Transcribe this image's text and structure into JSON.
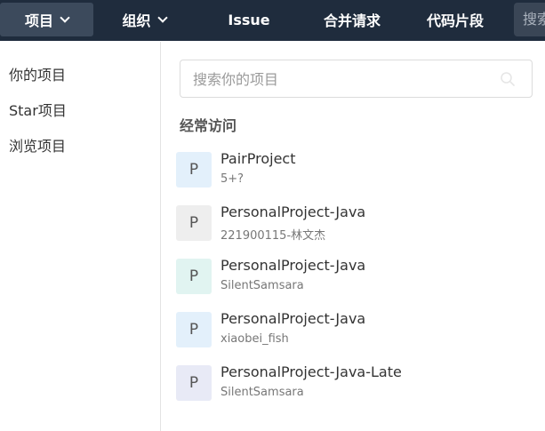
{
  "nav": {
    "items": [
      {
        "label": "项目",
        "has_dropdown": true,
        "active": true
      },
      {
        "label": "组织",
        "has_dropdown": true,
        "active": false
      },
      {
        "label": "Issue",
        "has_dropdown": false,
        "active": false
      },
      {
        "label": "合并请求",
        "has_dropdown": false,
        "active": false
      },
      {
        "label": "代码片段",
        "has_dropdown": false,
        "active": false
      }
    ],
    "search_text": "搜索"
  },
  "sidebar": {
    "items": [
      {
        "label": "你的项目"
      },
      {
        "label": "Star项目"
      },
      {
        "label": "浏览项目"
      }
    ]
  },
  "main": {
    "search": {
      "placeholder": "搜索你的项目",
      "value": ""
    },
    "section_title": "经常访问",
    "projects": [
      {
        "initial": "P",
        "name": "PairProject",
        "owner": "5+?",
        "avatar_color": "#e3f0fb"
      },
      {
        "initial": "P",
        "name": "PersonalProject-Java",
        "owner": "221900115-林文杰",
        "avatar_color": "#eeeeee"
      },
      {
        "initial": "P",
        "name": "PersonalProject-Java",
        "owner": "SilentSamsara",
        "avatar_color": "#e1f4f1"
      },
      {
        "initial": "P",
        "name": "PersonalProject-Java",
        "owner": "xiaobei_fish",
        "avatar_color": "#e3f0fb"
      },
      {
        "initial": "P",
        "name": "PersonalProject-Java-Late",
        "owner": "SilentSamsara",
        "avatar_color": "#e8eaf6"
      }
    ]
  },
  "colors": {
    "nav_bg": "#1f2c3d",
    "nav_active": "#3c4a5c"
  }
}
